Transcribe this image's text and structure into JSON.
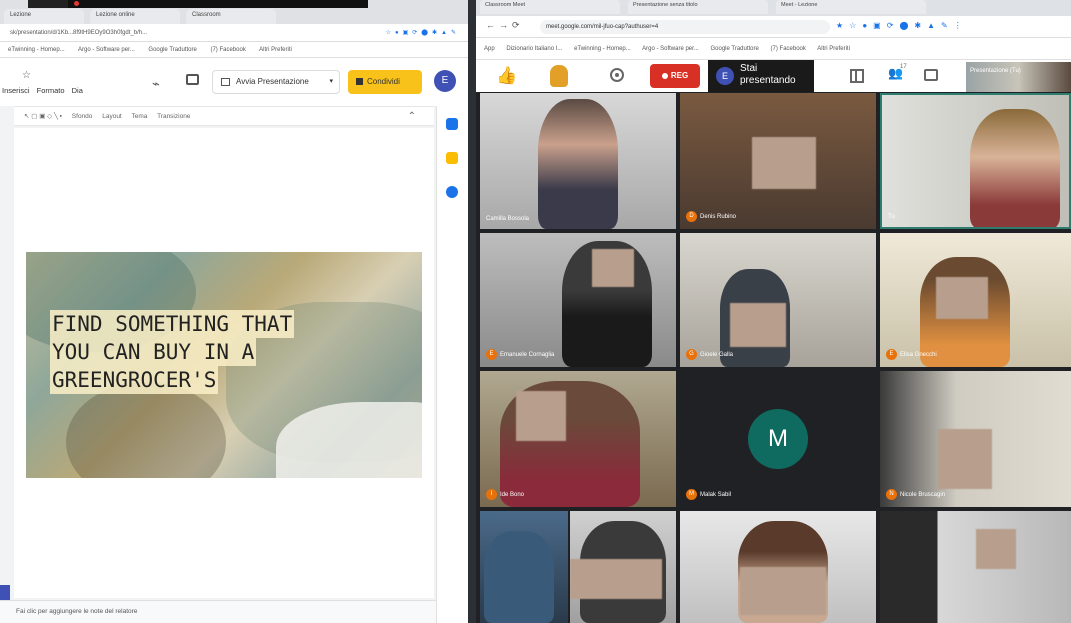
{
  "slides_window": {
    "tabs": [
      {
        "label": "Lezione"
      },
      {
        "label": "Lezione online"
      },
      {
        "label": "Classroom"
      }
    ],
    "address": "sk/presentation/d/1Kb...8f9tH9EOy9O3h0fgdt_b/h...",
    "bookmarks": [
      "eTwinning - Homep...",
      "Argo - Software per...",
      "Google Traduttore",
      "(7) Facebook",
      "Altri Preferiti"
    ],
    "menu": [
      "Inserisci",
      "Formato",
      "Dia"
    ],
    "present_label": "Avvia Presentazione",
    "present_caret": "▾",
    "share_label": "Condividi",
    "avatar_letter": "E",
    "toolbar": [
      "Sfondo",
      "Layout",
      "Tema",
      "Transizione"
    ],
    "toolbar_caret": "⌃",
    "slide_lines": [
      "FIND SOMETHING THAT",
      "YOU CAN BUY IN A",
      "GREENGROCER'S"
    ],
    "notes_placeholder": "Fai clic per aggiungere le note del relatore"
  },
  "meet_window": {
    "tabs": [
      {
        "label": "Classroom Meet"
      },
      {
        "label": "Presentazione senza titolo"
      },
      {
        "label": "Meet - Lezione"
      }
    ],
    "url": "meet.google.com/mil-jfuo-cap?authuser=4",
    "bookmarks": [
      "App",
      "Dizionario Italiano I...",
      "eTwinning - Homep...",
      "Argo - Software per...",
      "Google Traduttore",
      "(7) Facebook",
      "Altri Preferiti"
    ],
    "toolbar": {
      "rec_label": "REG",
      "presenting_avatar": "E",
      "presenting_text": "Stai presentando",
      "people_count": "17",
      "self_label": "Presentazione (Tu)"
    },
    "participants": [
      {
        "name": "Camilla Bossola",
        "initial": "C"
      },
      {
        "name": "Denis Rubino",
        "initial": "D"
      },
      {
        "name": "Tu",
        "initial": ""
      },
      {
        "name": "Emanuele Cornaglia",
        "initial": "E"
      },
      {
        "name": "Gioele Galla",
        "initial": "G"
      },
      {
        "name": "Elisa Gnecchi",
        "initial": "E"
      },
      {
        "name": "Ide Bono",
        "initial": "I"
      },
      {
        "name": "Malak Sabil",
        "initial": "M",
        "avatar_letter": "M"
      },
      {
        "name": "Nicole Bruscagin",
        "initial": "N"
      },
      {
        "name": "",
        "initial": ""
      },
      {
        "name": "",
        "initial": ""
      },
      {
        "name": "",
        "initial": ""
      },
      {
        "name": "",
        "initial": ""
      }
    ]
  }
}
